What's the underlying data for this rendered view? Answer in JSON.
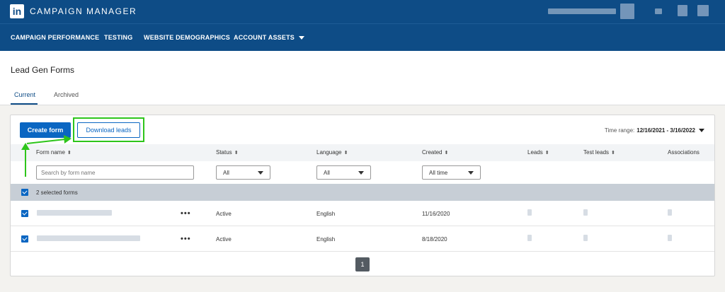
{
  "header": {
    "logo_text": "in",
    "app_title": "CAMPAIGN MANAGER"
  },
  "nav": {
    "items": [
      {
        "label": "CAMPAIGN PERFORMANCE"
      },
      {
        "label": "TESTING"
      },
      {
        "label": "WEBSITE DEMOGRAPHICS"
      },
      {
        "label": "ACCOUNT ASSETS"
      }
    ]
  },
  "page": {
    "title": "Lead Gen Forms",
    "tabs": [
      {
        "label": "Current",
        "active": true
      },
      {
        "label": "Archived",
        "active": false
      }
    ]
  },
  "toolbar": {
    "create_label": "Create form",
    "download_label": "Download leads",
    "time_range_label": "Time range:",
    "time_range_value": "12/16/2021 - 3/16/2022"
  },
  "table": {
    "columns": [
      "Form name",
      "Status",
      "Language",
      "Created",
      "Leads",
      "Test leads",
      "Associations"
    ],
    "filters": {
      "search_placeholder": "Search by form name",
      "status": "All",
      "language": "All",
      "created": "All time"
    },
    "selection_label": "2 selected forms",
    "rows": [
      {
        "status": "Active",
        "language": "English",
        "created": "11/16/2020"
      },
      {
        "status": "Active",
        "language": "English",
        "created": "8/18/2020"
      }
    ]
  },
  "pagination": {
    "current": "1"
  },
  "colors": {
    "header_bg": "#0e4c86",
    "primary": "#0a66c2",
    "annotation": "#2ec51b"
  }
}
